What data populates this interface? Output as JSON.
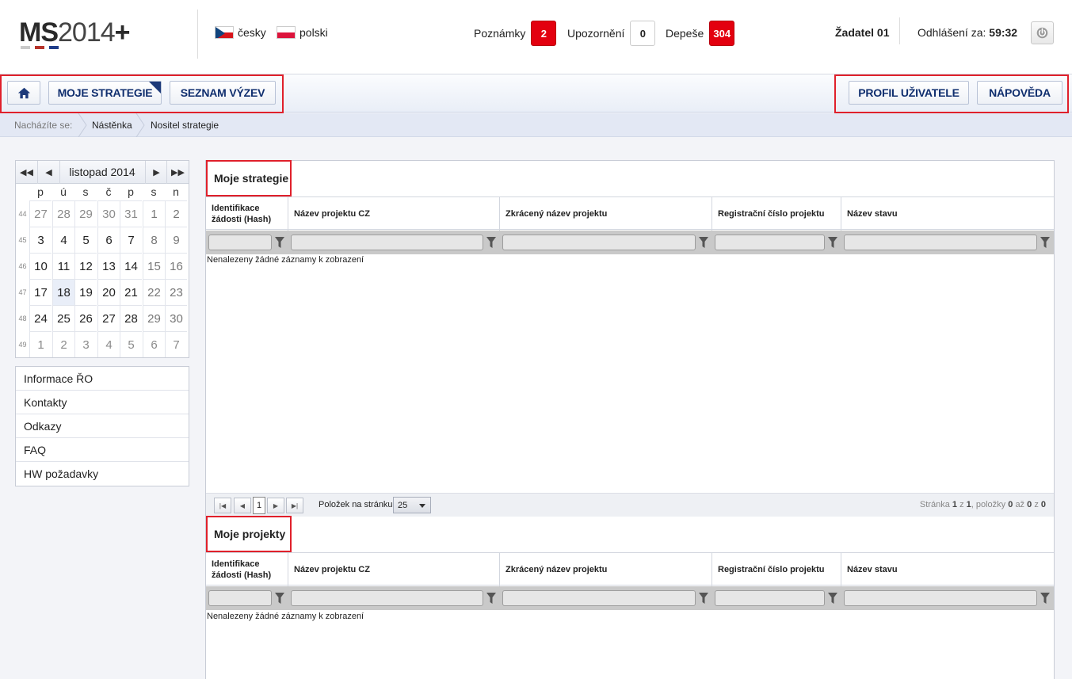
{
  "header": {
    "logo_ms": "MS",
    "logo_year": "2014",
    "logo_plus": "+",
    "languages": [
      {
        "label": "česky",
        "flag": "cz-flag-icon"
      },
      {
        "label": "polski",
        "flag": "pl-flag-icon"
      }
    ],
    "notifications": [
      {
        "label": "Poznámky",
        "count": "2",
        "style": "red"
      },
      {
        "label": "Upozornění",
        "count": "0",
        "style": "white"
      },
      {
        "label": "Depeše",
        "count": "304",
        "style": "red"
      }
    ],
    "user": "Žadatel 01",
    "logout_label": "Odhlášení za:",
    "logout_time": "59:32"
  },
  "nav": {
    "left": [
      "MOJE STRATEGIE",
      "SEZNAM VÝZEV"
    ],
    "right": [
      "PROFIL UŽIVATELE",
      "NÁPOVĚDA"
    ]
  },
  "breadcrumb": {
    "prefix": "Nacházíte se:",
    "items": [
      "Nástěnka",
      "Nositel strategie"
    ]
  },
  "calendar": {
    "title": "listopad 2014",
    "days_of_week": [
      "p",
      "ú",
      "s",
      "č",
      "p",
      "s",
      "n"
    ],
    "weeks": [
      {
        "num": "44",
        "days": [
          "27",
          "28",
          "29",
          "30",
          "31",
          "1",
          "2"
        ]
      },
      {
        "num": "45",
        "days": [
          "3",
          "4",
          "5",
          "6",
          "7",
          "8",
          "9"
        ]
      },
      {
        "num": "46",
        "days": [
          "10",
          "11",
          "12",
          "13",
          "14",
          "15",
          "16"
        ]
      },
      {
        "num": "47",
        "days": [
          "17",
          "18",
          "19",
          "20",
          "21",
          "22",
          "23"
        ]
      },
      {
        "num": "48",
        "days": [
          "24",
          "25",
          "26",
          "27",
          "28",
          "29",
          "30"
        ]
      },
      {
        "num": "49",
        "days": [
          "1",
          "2",
          "3",
          "4",
          "5",
          "6",
          "7"
        ]
      }
    ],
    "today": "18"
  },
  "side_menu": [
    "Informace ŘO",
    "Kontakty",
    "Odkazy",
    "FAQ",
    "HW požadavky"
  ],
  "strategies": {
    "title": "Moje strategie",
    "columns": [
      "Identifikace žádosti (Hash)",
      "Název projektu CZ",
      "Zkrácený název projektu",
      "Registrační číslo projektu",
      "Název stavu"
    ],
    "empty_text": "Nenalezeny žádné záznamy k zobrazení",
    "pager": {
      "current_page": "1",
      "per_page_label": "Položek na stránku",
      "per_page": "25",
      "info_prefix": "Stránka",
      "page": "1",
      "of": "z",
      "pages": "1",
      "items_label": ", položky",
      "from": "0",
      "to_label": "až",
      "to": "0",
      "of2": "z",
      "total": "0"
    }
  },
  "projects": {
    "title": "Moje projekty",
    "columns": [
      "Identifikace žádosti (Hash)",
      "Název projektu CZ",
      "Zkrácený název projektu",
      "Registrační číslo projektu",
      "Název stavu"
    ],
    "empty_text": "Nenalezeny žádné záznamy k zobrazení"
  },
  "colors": {
    "accent_red": "#e3000f",
    "nav_text": "#0f2e6e",
    "highlight_border": "#e0202b"
  }
}
